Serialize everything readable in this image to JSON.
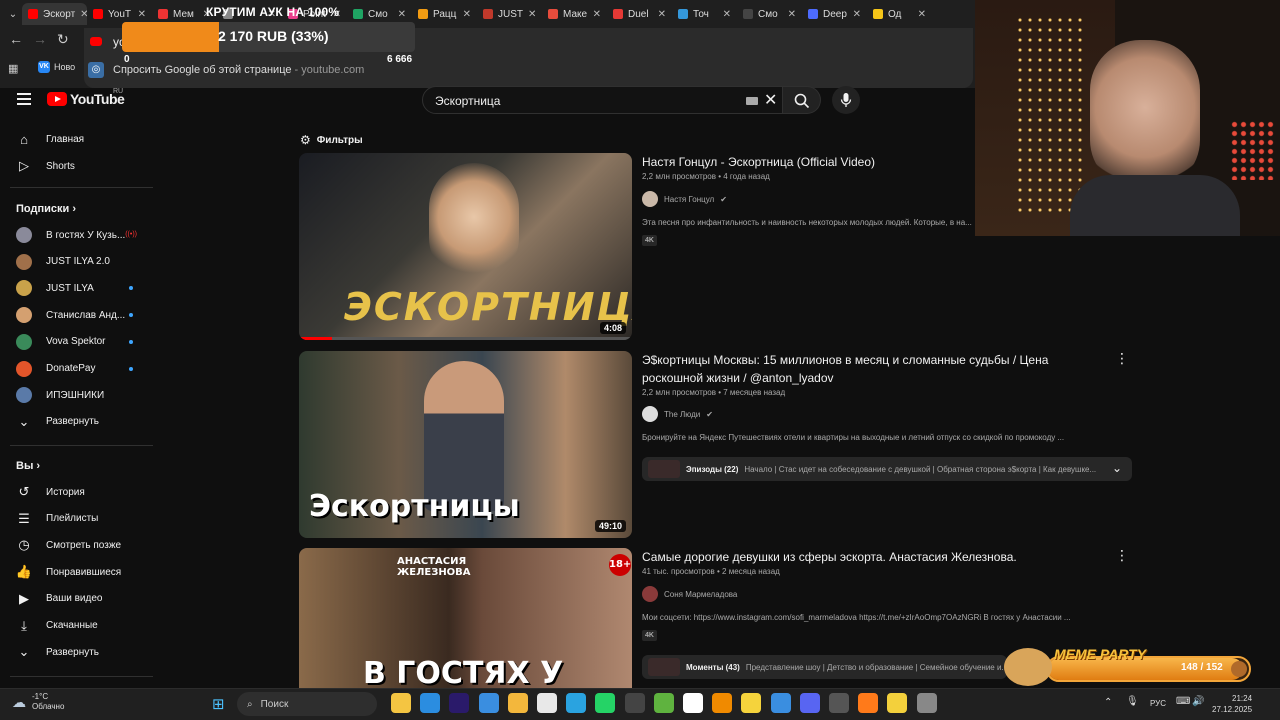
{
  "browser": {
    "tabs": [
      {
        "label": "Эскорт",
        "color": "#ff0000",
        "active": true
      },
      {
        "label": "YouT",
        "color": "#ff0000"
      },
      {
        "label": "Мем",
        "color": "#e33"
      },
      {
        "label": "",
        "color": "#888"
      },
      {
        "label": "Point",
        "color": "#e83e8c"
      },
      {
        "label": "Смо",
        "color": "#1fa463"
      },
      {
        "label": "Рацц",
        "color": "#f39c12"
      },
      {
        "label": "JUST",
        "color": "#c0392b"
      },
      {
        "label": "Маке",
        "color": "#e74c3c"
      },
      {
        "label": "Duel",
        "color": "#e53935"
      },
      {
        "label": "Точ",
        "color": "#3498db"
      },
      {
        "label": "Смо",
        "color": "#444"
      },
      {
        "label": "Deep",
        "color": "#4d6bfe"
      },
      {
        "label": "Од",
        "color": "#f5c518"
      }
    ],
    "omnibox_text": "yo",
    "ask_google_label": "Спросить Google об этой странице",
    "ask_google_domain": " - youtube.com",
    "bookmark_label": "Ново"
  },
  "auction": {
    "title": "КРУТИМ АУК НА 100%",
    "value_text": "2 170 RUB (33%)",
    "progress_percent": 33,
    "min": "0",
    "max": "6 666"
  },
  "youtube": {
    "logo_text": "YouTube",
    "country": "RU",
    "search_query": "Эскортница",
    "filters_label": "Фильтры",
    "sidebar": {
      "main": [
        {
          "label": "Главная",
          "icon": "home-icon"
        },
        {
          "label": "Shorts",
          "icon": "shorts-icon"
        }
      ],
      "subscriptions_title": "Подписки",
      "subscriptions": [
        {
          "label": "В гостях У Кузь...",
          "color": "#8a8a9a",
          "live": true
        },
        {
          "label": "JUST ILYA 2.0",
          "color": "#a0704a"
        },
        {
          "label": "JUST ILYA",
          "color": "#c9a24a",
          "dot": true
        },
        {
          "label": "Станислав Анд...",
          "color": "#d4a070",
          "dot": true
        },
        {
          "label": "Vova Spektor",
          "color": "#3a8a5a",
          "dot": true
        },
        {
          "label": "DonatePay",
          "color": "#e2552a",
          "dot": true
        },
        {
          "label": "ИПЭШНИКИ",
          "color": "#5a7aa8"
        },
        {
          "label": "Развернуть",
          "icon": "chevron-down-icon"
        }
      ],
      "you_title": "Вы",
      "you": [
        {
          "label": "История",
          "icon": "history-icon"
        },
        {
          "label": "Плейлисты",
          "icon": "playlist-icon"
        },
        {
          "label": "Смотреть позже",
          "icon": "clock-icon"
        },
        {
          "label": "Понравившиеся",
          "icon": "like-icon"
        },
        {
          "label": "Ваши видео",
          "icon": "video-icon"
        },
        {
          "label": "Скачанные",
          "icon": "download-icon"
        },
        {
          "label": "Развернуть",
          "icon": "chevron-down-icon"
        }
      ]
    },
    "videos": [
      {
        "title": "Настя Гонцул - Эскортница (Official Video)",
        "views": "2,2 млн просмотров",
        "age": "4 года назад",
        "channel": "Настя Гонцул",
        "verified": true,
        "description": "Эта песня про инфантильность и наивность некоторых молодых людей. Которые, в на...",
        "badge": "4K",
        "duration": "4:08",
        "thumb_text": "ЭСКОРТНИЦА"
      },
      {
        "title": "Э$кортницы Москвы: 15 миллионов в месяц и сломанные судьбы / Цена роскошной жизни / @anton_lyadov",
        "views": "2,2 млн просмотров",
        "age": "7 месяцев назад",
        "channel": "The Люди",
        "verified": true,
        "description": "Бронируйте на Яндекс Путешествиях отели и квартиры на выходные и летний отпуск со скидкой по промокоду ...",
        "chapters_label": "Эпизоды (22)",
        "chapters_text": "Начало | Стас идет на собеседование с девушкой | Обратная сторона э$корта | Как девушке...",
        "duration": "49:10",
        "thumb_text": "Эскортницы"
      },
      {
        "title": "Самые дорогие девушки из сферы эскорта. Анастасия Железнова.",
        "views": "41 тыс. просмотров",
        "age": "2 месяца назад",
        "channel": "Соня Мармеладова",
        "description": "Мои соцсети: https://www.instagram.com/sofi_marmeladova https://t.me/+zIrAoOmp7OAzNGRi В гостях у Анастасии ...",
        "badge": "4K",
        "chapters_label": "Моменты (43)",
        "chapters_text": "Представление шоу | Детство и образование | Семейное обучение и...",
        "thumb_text": "В ГОСТЯХ У",
        "thumb_caption": "АНАСТАСИЯ ЖЕЛЕЗНОВА",
        "thumb_age": "18+"
      }
    ]
  },
  "overlay": {
    "meme_title": "MEME PARTY",
    "meme_count": "148 / 152",
    "meme_progress": 0.97
  },
  "taskbar": {
    "temperature": "-1°C",
    "weather": "Облачно",
    "search_label": "Поиск",
    "lang": "РУС",
    "time": "21:24",
    "date": "27.12.2025"
  }
}
